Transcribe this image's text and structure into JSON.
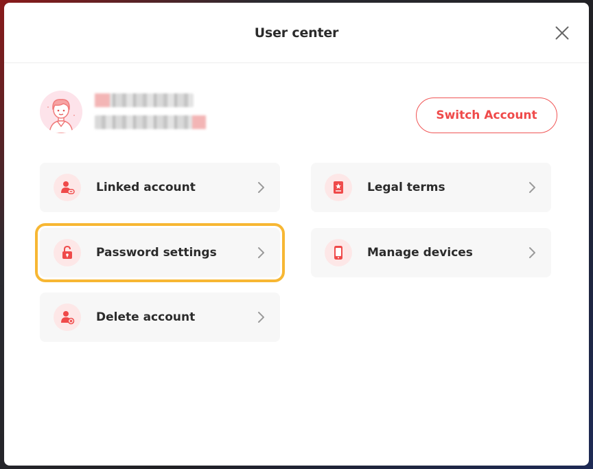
{
  "dialog": {
    "title": "User center",
    "close_icon": "close-icon"
  },
  "profile": {
    "avatar_icon": "avatar-icon",
    "switch_label": "Switch Account"
  },
  "menu": [
    {
      "label": "Linked account",
      "icon": "linked-account-icon"
    },
    {
      "label": "Legal terms",
      "icon": "legal-terms-icon"
    },
    {
      "label": "Password settings",
      "icon": "lock-icon"
    },
    {
      "label": "Manage devices",
      "icon": "device-icon"
    },
    {
      "label": "Delete account",
      "icon": "delete-account-icon"
    }
  ],
  "colors": {
    "accent": "#ef4a4a",
    "highlight": "#f7b733",
    "icon_bg": "#fde7e7"
  }
}
